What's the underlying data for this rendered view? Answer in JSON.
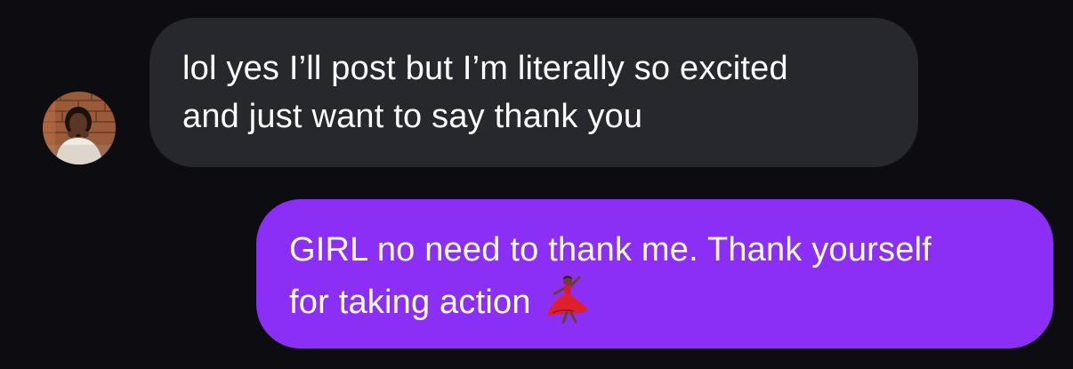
{
  "conversation": {
    "messages": [
      {
        "sender": "other",
        "lines": [
          "lol yes I’ll post but I’m literally so excited",
          "and just want to say thank you"
        ]
      },
      {
        "sender": "me",
        "lines": [
          "GIRL no need to thank me. Thank yourself",
          "for taking action"
        ],
        "emoji": "dancer-emoji"
      }
    ]
  },
  "icons": {
    "avatar": "profile-avatar",
    "emoji": "woman-dancing-emoji"
  },
  "colors": {
    "background": "#0c0c11",
    "incoming_bubble": "#26282e",
    "outgoing_bubble": "#8b2ff6",
    "text": "#ffffff"
  }
}
